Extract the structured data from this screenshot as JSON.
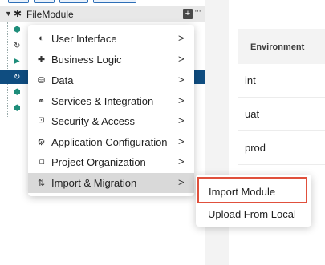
{
  "tree": {
    "title": "FileModule",
    "chevron_icon": "chevron-down-icon",
    "module_icon": "puzzle-icon",
    "plus_label": "+",
    "more_label": "···",
    "rows": [
      {
        "icon": "cube-icon",
        "glyph": "⬢"
      },
      {
        "icon": "loop-icon",
        "glyph": "↻"
      },
      {
        "icon": "flow-icon",
        "glyph": "▶"
      },
      {
        "icon": "loop-icon",
        "glyph": "↻",
        "selected": true
      },
      {
        "icon": "cube-icon",
        "glyph": "⬢"
      },
      {
        "icon": "cube-icon",
        "glyph": "⬢"
      }
    ]
  },
  "table": {
    "header": "Environment",
    "rows": [
      "int",
      "uat",
      "prod"
    ]
  },
  "menu": {
    "items": [
      {
        "label": "User Interface",
        "icon": "palette-icon",
        "glyph": "◐",
        "arrow": ">"
      },
      {
        "label": "Business Logic",
        "icon": "puzzle-icon",
        "glyph": "✚",
        "arrow": ">"
      },
      {
        "label": "Data",
        "icon": "database-icon",
        "glyph": "⛁",
        "arrow": ">"
      },
      {
        "label": "Services & Integration",
        "icon": "link-icon",
        "glyph": "⚭",
        "arrow": ">"
      },
      {
        "label": "Security & Access",
        "icon": "lock-icon",
        "glyph": "🔒",
        "arrow": ">"
      },
      {
        "label": "Application Configuration",
        "icon": "gear-icon",
        "glyph": "⚙",
        "arrow": ">"
      },
      {
        "label": "Project Organization",
        "icon": "sitemap-icon",
        "glyph": "⧉",
        "arrow": ">"
      },
      {
        "label": "Import & Migration",
        "icon": "swap-icon",
        "glyph": "⇅",
        "arrow": ">",
        "active": true
      }
    ]
  },
  "submenu": {
    "items": [
      "Import Module",
      "Upload From Local"
    ]
  },
  "colors": {
    "selected_row": "#0f4d80",
    "highlight_border": "#e0503c",
    "menu_active": "#d9d9d9"
  }
}
